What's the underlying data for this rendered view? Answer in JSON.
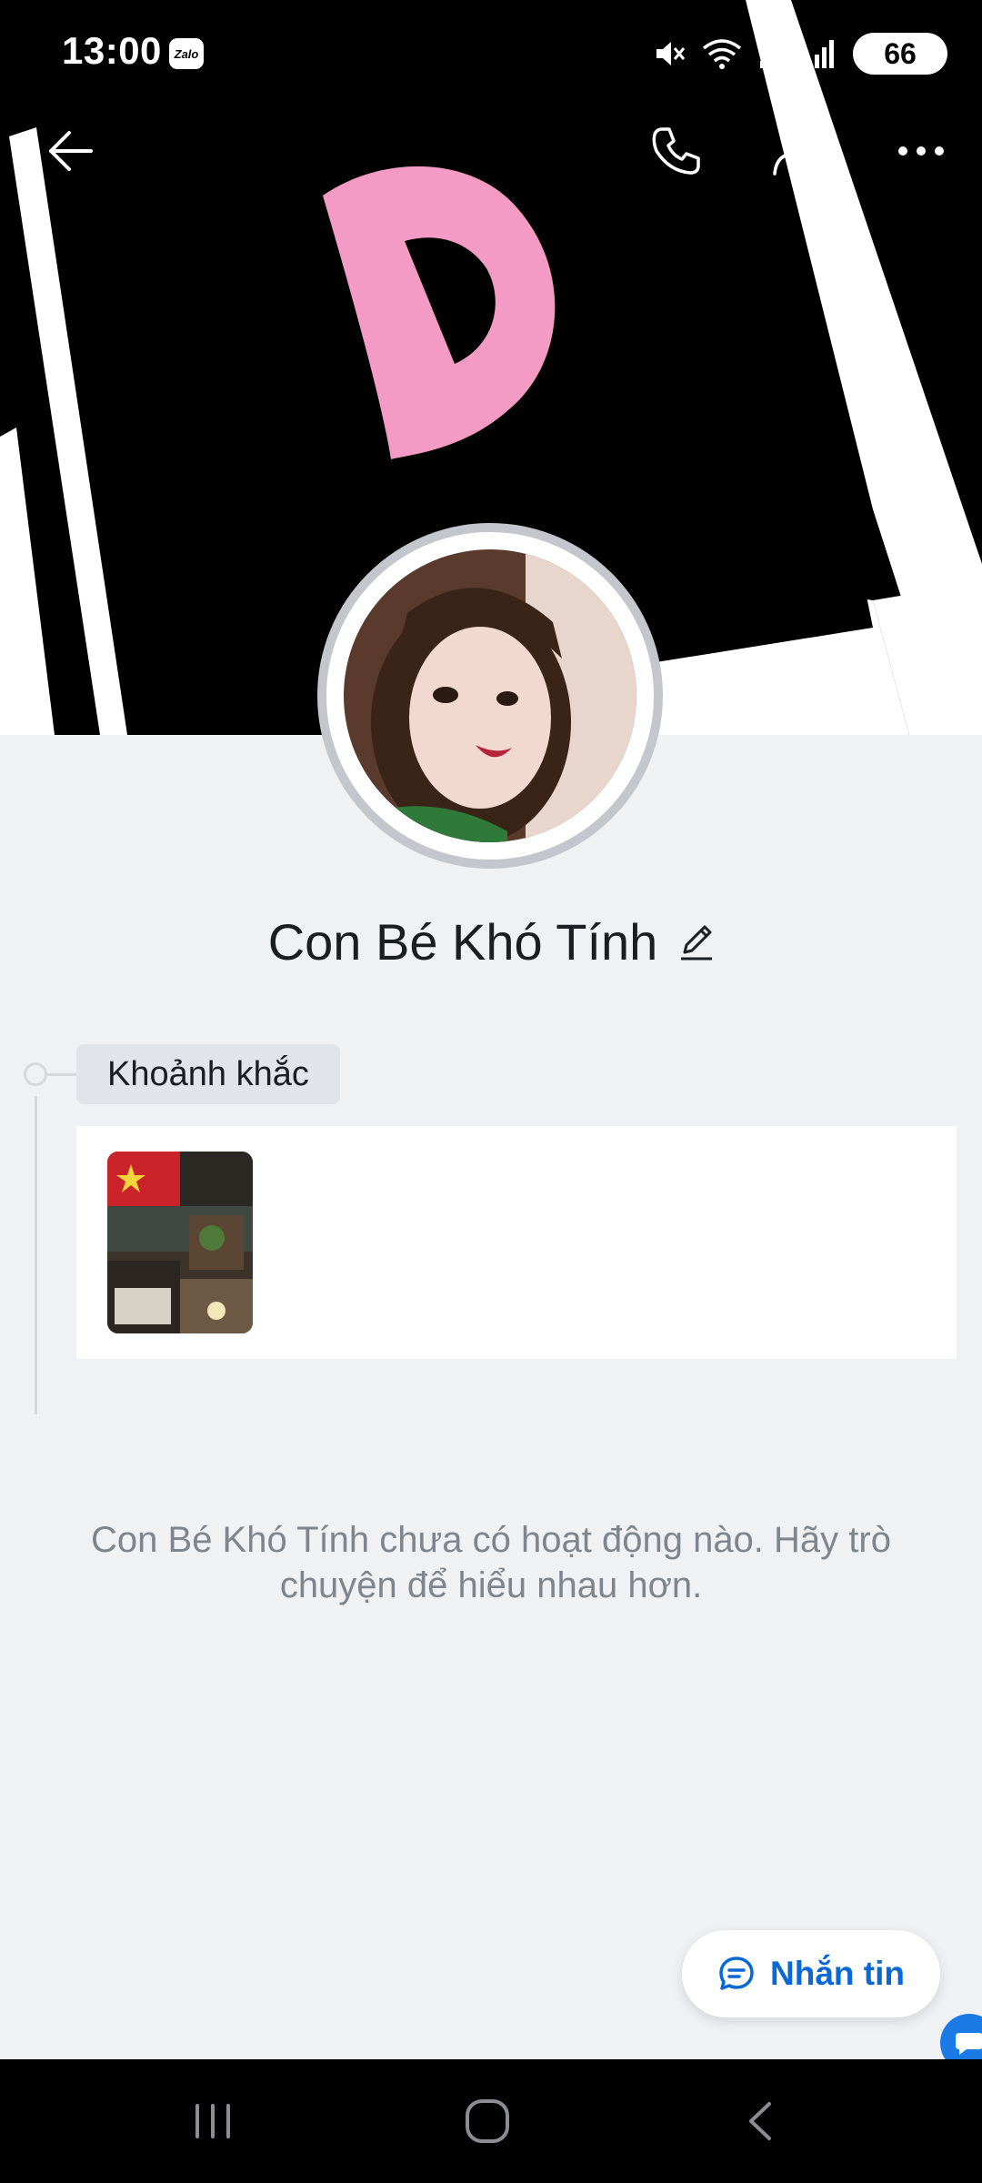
{
  "status_bar": {
    "time": "13:00",
    "app_badge": "Zalo",
    "battery": "66",
    "icons": [
      "mute-icon",
      "wifi-icon",
      "signal-icon",
      "signal-icon"
    ]
  },
  "top_nav": {
    "icons": [
      "back-arrow-icon",
      "phone-icon",
      "user-settings-icon",
      "more-icon"
    ]
  },
  "profile": {
    "name": "Con Bé Khó Tính",
    "edit_icon": "pencil-icon"
  },
  "moments": {
    "title": "Khoảnh khắc"
  },
  "empty_state": {
    "text": "Con Bé Khó Tính chưa có hoạt động nào. Hãy trò chuyện để hiểu nhau hơn."
  },
  "actions": {
    "message_label": "Nhắn tin"
  },
  "colors": {
    "accent": "#0a68d6",
    "background": "#eff1f5",
    "cover_pink": "#f39bc4"
  }
}
